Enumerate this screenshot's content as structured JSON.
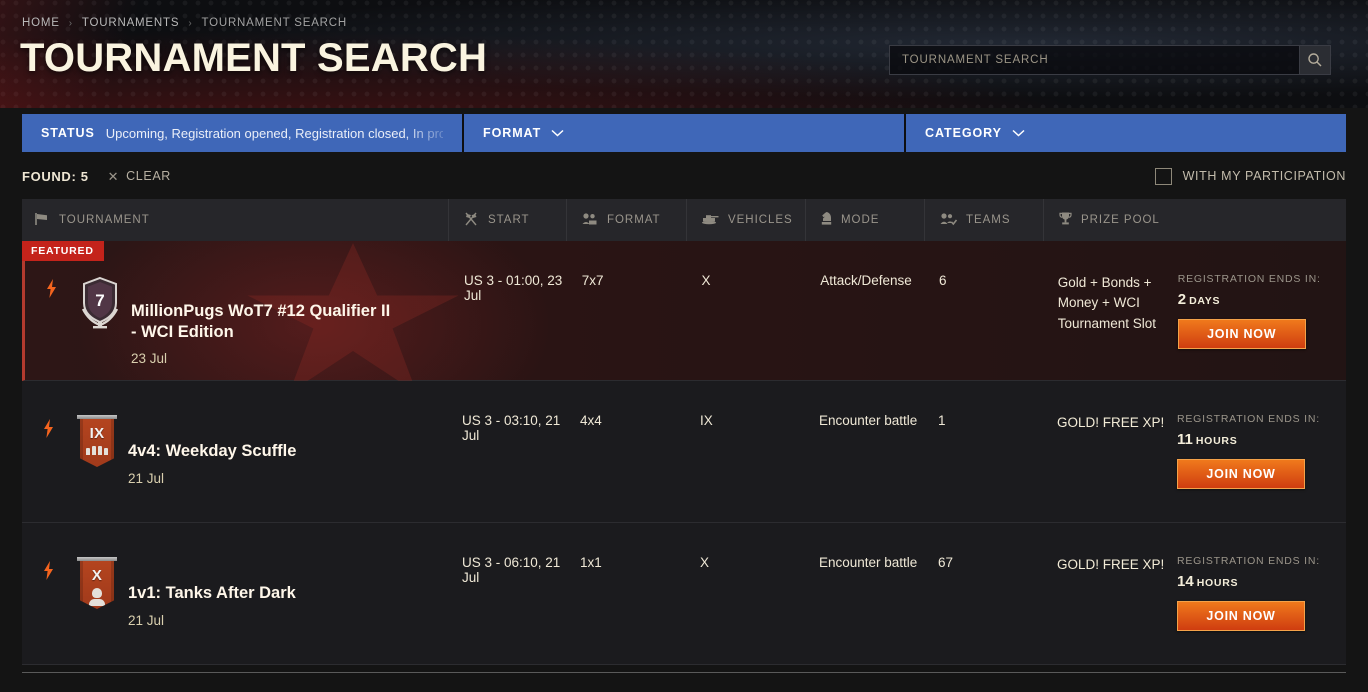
{
  "breadcrumb": [
    {
      "label": "HOME"
    },
    {
      "label": "TOURNAMENTS"
    },
    {
      "label": "TOURNAMENT SEARCH"
    }
  ],
  "page": {
    "title": "TOURNAMENT SEARCH"
  },
  "search": {
    "placeholder": "TOURNAMENT SEARCH",
    "value": "",
    "icon": "search-icon",
    "button_title": "Search"
  },
  "filters": [
    {
      "label": "STATUS",
      "value": "Upcoming, Registration opened, Registration closed, In progress",
      "has_chevron": false
    },
    {
      "label": "FORMAT",
      "value": "",
      "has_chevron": true,
      "chevron": "⌄"
    },
    {
      "label": "CATEGORY",
      "value": "",
      "has_chevron": true,
      "chevron": "⌄"
    }
  ],
  "results": {
    "found_label": "FOUND: 5",
    "clear_label": "CLEAR",
    "clear_icon": "close-icon",
    "participation_label": "WITH MY PARTICIPATION",
    "participation_checked": false
  },
  "table": {
    "columns": [
      {
        "key": "tournament",
        "label": "TOURNAMENT",
        "icon": "flag-icon"
      },
      {
        "key": "start",
        "label": "START",
        "icon": "crossed-flags-icon"
      },
      {
        "key": "format",
        "label": "FORMAT",
        "icon": "team-format-icon"
      },
      {
        "key": "vehicles",
        "label": "VEHICLES",
        "icon": "tank-icon"
      },
      {
        "key": "mode",
        "label": "MODE",
        "icon": "chess-knight-icon"
      },
      {
        "key": "teams",
        "label": "TEAMS",
        "icon": "teams-check-icon"
      },
      {
        "key": "prize",
        "label": "PRIZE POOL",
        "icon": "trophy-icon"
      }
    ],
    "rows": [
      {
        "featured": true,
        "featured_label": "FEATURED",
        "live_icon": "lightning-bolt-icon",
        "badge": {
          "type": "emblem",
          "tier": "7"
        },
        "name": "MillionPugs WoT7 #12 Qualifier II - WCI Edition",
        "date": "23 Jul",
        "start": "US 3 - 01:00, 23 Jul",
        "format": "7x7",
        "vehicles": "X",
        "mode": "Attack/Defense",
        "teams": "6",
        "prize": "Gold + Bonds + Money + WCI Tournament Slot",
        "reg_label": "REGISTRATION ENDS IN:",
        "reg_value": "2",
        "reg_unit": "DAYS",
        "join_label": "JOIN NOW"
      },
      {
        "featured": false,
        "featured_label": "",
        "live_icon": "lightning-bolt-icon",
        "badge": {
          "type": "banner",
          "tier": "IX",
          "glyph": "team-pips"
        },
        "name": "4v4: Weekday Scuffle",
        "date": "21 Jul",
        "start": "US 3 - 03:10, 21 Jul",
        "format": "4x4",
        "vehicles": "IX",
        "mode": "Encounter battle",
        "teams": "1",
        "prize": "GOLD! FREE XP!",
        "reg_label": "REGISTRATION ENDS IN:",
        "reg_value": "11",
        "reg_unit": "HOURS",
        "join_label": "JOIN NOW"
      },
      {
        "featured": false,
        "featured_label": "",
        "live_icon": "lightning-bolt-icon",
        "badge": {
          "type": "banner",
          "tier": "X",
          "glyph": "single-person"
        },
        "name": "1v1: Tanks After Dark",
        "date": "21 Jul",
        "start": "US 3 - 06:10, 21 Jul",
        "format": "1x1",
        "vehicles": "X",
        "mode": "Encounter battle",
        "teams": "67",
        "prize": "GOLD! FREE XP!",
        "reg_label": "REGISTRATION ENDS IN:",
        "reg_value": "14",
        "reg_unit": "HOURS",
        "join_label": "JOIN NOW"
      }
    ]
  },
  "colors": {
    "filter_blue": "#3f67b8",
    "featured_red": "#c4231b",
    "join_orange": "#f0791c",
    "page_bg": "#141414",
    "row_bg": "#1b1b1e",
    "header_row_bg": "#26262a"
  }
}
